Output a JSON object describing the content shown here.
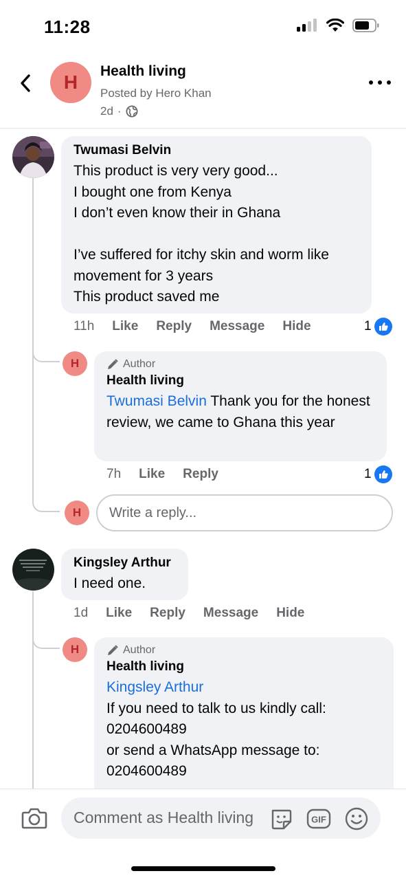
{
  "status_bar": {
    "time": "11:28"
  },
  "header": {
    "page_initial": "H",
    "title": "Health living",
    "posted_by": "Posted by Hero Khan",
    "age": "2d",
    "separator": "·"
  },
  "comments": [
    {
      "author": "Twumasi Belvin",
      "text": "This product is very very good...\nI bought one from Kenya\nI don’t even know their in Ghana\n\nI’ve suffered for itchy skin and worm like movement for 3 years\nThis product saved me",
      "time": "11h",
      "actions": [
        "Like",
        "Reply",
        "Message",
        "Hide"
      ],
      "likes": "1",
      "reply": {
        "avatar_initial": "H",
        "badge": "Author",
        "author": "Health living",
        "mention": "Twumasi Belvin",
        "text": " Thank you for the honest review, we came to Ghana this year",
        "time": "7h",
        "actions": [
          "Like",
          "Reply"
        ],
        "likes": "1"
      },
      "reply_input": {
        "avatar_initial": "H",
        "placeholder": "Write a reply..."
      }
    },
    {
      "author": "Kingsley Arthur",
      "text": "I need one.",
      "time": "1d",
      "actions": [
        "Like",
        "Reply",
        "Message",
        "Hide"
      ],
      "reply": {
        "avatar_initial": "H",
        "badge": "Author",
        "author": "Health living",
        "mention": "Kingsley Arthur",
        "text": "If you need to talk to us kindly call:\n0204600489\nor send a WhatsApp message to:\n0204600489"
      }
    }
  ],
  "composer": {
    "placeholder": "Comment as Health living",
    "gif_label": "GIF"
  },
  "icons": [
    "back-icon",
    "globe-icon",
    "more-icon",
    "pencil-icon",
    "like-icon",
    "camera-icon",
    "sticker-icon",
    "gif-icon",
    "emoji-icon",
    "signal-icon",
    "wifi-icon",
    "battery-icon"
  ],
  "colors": {
    "accent": "#1877f2",
    "mention": "#1a6ed8",
    "avatar_bg": "#f08a85",
    "bubble": "#f0f2f5"
  }
}
